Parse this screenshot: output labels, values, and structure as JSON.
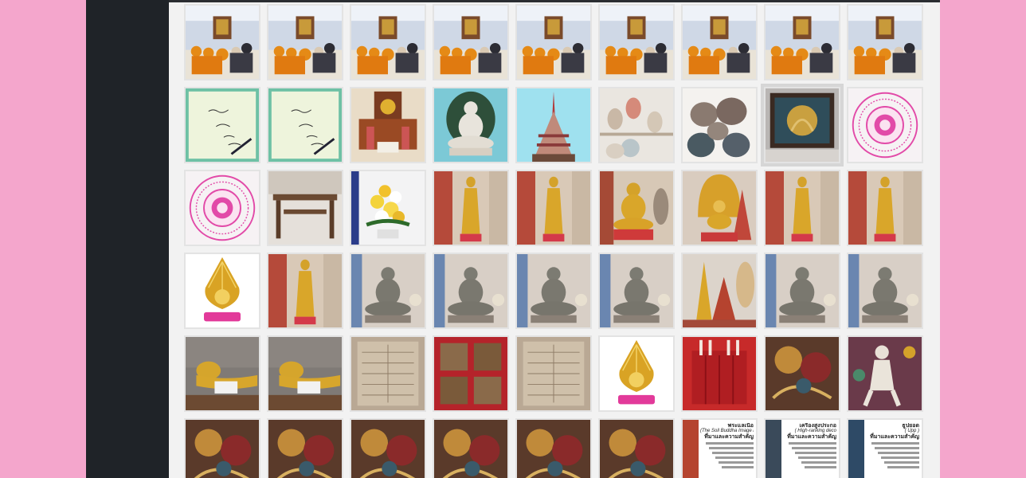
{
  "sidebar": {},
  "gallery": {
    "tiles": [
      {
        "kind": "ceremony"
      },
      {
        "kind": "ceremony"
      },
      {
        "kind": "ceremony"
      },
      {
        "kind": "ceremony"
      },
      {
        "kind": "ceremony"
      },
      {
        "kind": "ceremony"
      },
      {
        "kind": "ceremony"
      },
      {
        "kind": "ceremony"
      },
      {
        "kind": "ceremony"
      },
      {
        "kind": "signature"
      },
      {
        "kind": "signature"
      },
      {
        "kind": "altar"
      },
      {
        "kind": "buddha-white"
      },
      {
        "kind": "pagoda"
      },
      {
        "kind": "shelf"
      },
      {
        "kind": "pots"
      },
      {
        "kind": "painting-framed"
      },
      {
        "kind": "seal"
      },
      {
        "kind": "seal"
      },
      {
        "kind": "table"
      },
      {
        "kind": "flowers"
      },
      {
        "kind": "gold-standing"
      },
      {
        "kind": "gold-standing"
      },
      {
        "kind": "gold-seated"
      },
      {
        "kind": "naga"
      },
      {
        "kind": "gold-standing"
      },
      {
        "kind": "gold-standing"
      },
      {
        "kind": "emblem"
      },
      {
        "kind": "gold-standing"
      },
      {
        "kind": "stone-seated"
      },
      {
        "kind": "stone-seated"
      },
      {
        "kind": "stone-seated"
      },
      {
        "kind": "stone-seated"
      },
      {
        "kind": "pagoda-small"
      },
      {
        "kind": "stone-seated"
      },
      {
        "kind": "stone-seated"
      },
      {
        "kind": "reclining"
      },
      {
        "kind": "reclining"
      },
      {
        "kind": "manuscript"
      },
      {
        "kind": "manuscript-red"
      },
      {
        "kind": "manuscript"
      },
      {
        "kind": "emblem"
      },
      {
        "kind": "red-frame"
      },
      {
        "kind": "mural"
      },
      {
        "kind": "mural-figure"
      },
      {
        "kind": "mural"
      },
      {
        "kind": "mural"
      },
      {
        "kind": "mural"
      },
      {
        "kind": "mural"
      },
      {
        "kind": "mural"
      },
      {
        "kind": "mural"
      },
      {
        "kind": "poster-1"
      },
      {
        "kind": "poster-2"
      },
      {
        "kind": "poster-3"
      }
    ],
    "posters": {
      "poster1": {
        "line1": "พระแลเนื้อ",
        "line2": "(The Soil Buddha Image i",
        "line3": "ที่มาและความสำคัญ"
      },
      "poster2": {
        "line1": "เครื่องสูงประกอ",
        "line2": "( High-ranking deco",
        "line3": "ที่มาและความสำคัญ"
      },
      "poster3": {
        "line1": "ธูปยอด",
        "line2": "( Upp )",
        "line3": "ที่มาและความสำคัญ"
      }
    },
    "selected_index": 16
  },
  "colors": {
    "page_bg": "#f4a6cc",
    "sidebar": "#1f2328",
    "gallery_bg": "#f2f2f2",
    "gold": "#d4a22a",
    "monk_robe": "#e58a16",
    "seal_pink": "#e24aa8"
  }
}
